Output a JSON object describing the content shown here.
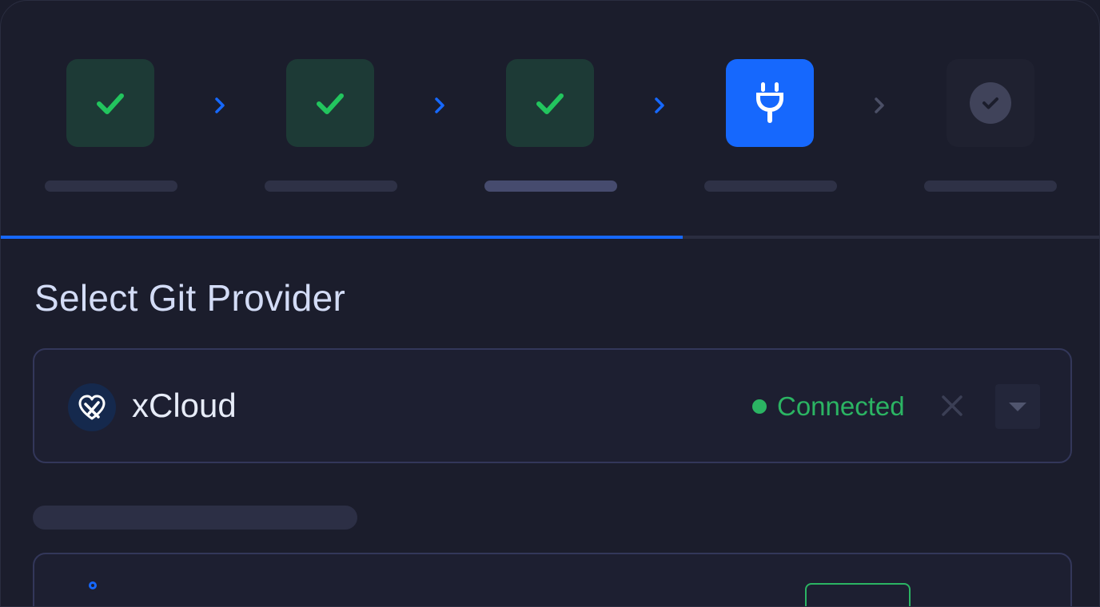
{
  "wizard": {
    "steps": [
      {
        "state": "done",
        "icon": "check-icon"
      },
      {
        "state": "done",
        "icon": "check-icon"
      },
      {
        "state": "done",
        "icon": "check-icon"
      },
      {
        "state": "active",
        "icon": "plug-icon"
      },
      {
        "state": "pending",
        "icon": "check-circle-icon"
      }
    ],
    "progress_percent": 62
  },
  "section": {
    "title": "Select Git Provider"
  },
  "provider": {
    "name": "xCloud",
    "status": "Connected",
    "icon": "xcloud-logo-icon"
  },
  "colors": {
    "accent": "#1668fd",
    "success": "#2bb463",
    "background": "#1b1d2c"
  }
}
